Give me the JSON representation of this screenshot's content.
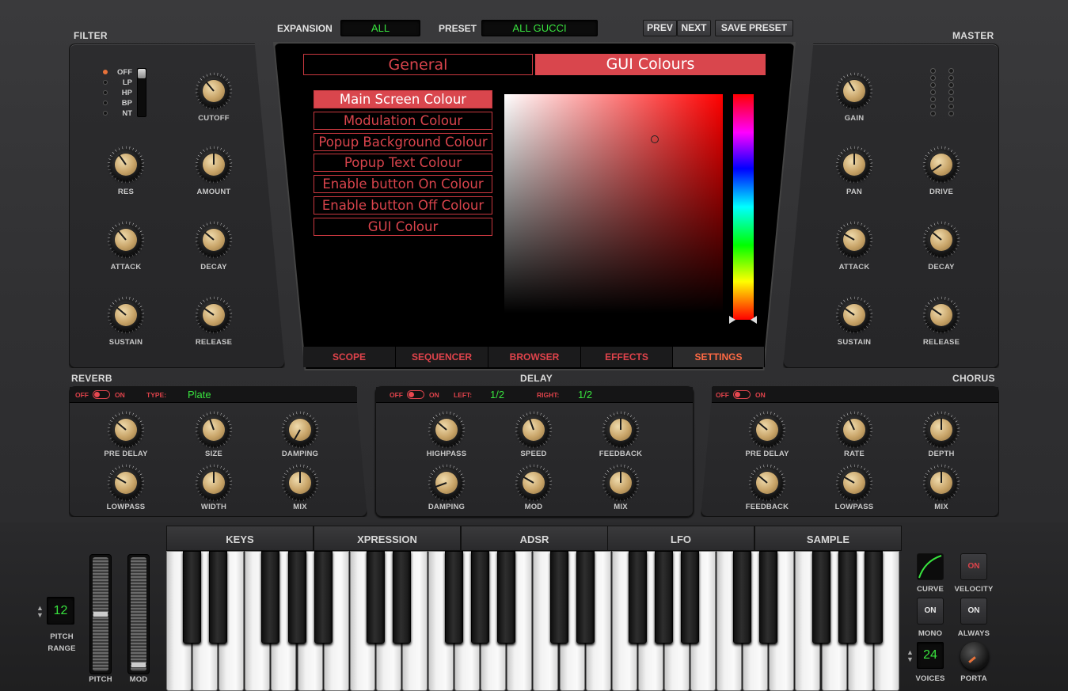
{
  "header": {
    "expansion_label": "EXPANSION",
    "expansion_value": "ALL",
    "preset_label": "PRESET",
    "preset_value": "ALL GUCCI",
    "prev": "PREV",
    "next": "NEXT",
    "save": "SAVE PRESET"
  },
  "filter": {
    "title": "FILTER",
    "modes": [
      "OFF",
      "LP",
      "HP",
      "BP",
      "NT"
    ],
    "active_mode": "OFF",
    "knobs": [
      {
        "label": "CUTOFF",
        "angle": -40
      },
      {
        "label": "RES",
        "angle": -35
      },
      {
        "label": "AMOUNT",
        "angle": 0
      },
      {
        "label": "ATTACK",
        "angle": -40
      },
      {
        "label": "DECAY",
        "angle": -50
      },
      {
        "label": "SUSTAIN",
        "angle": -50
      },
      {
        "label": "RELEASE",
        "angle": -55
      }
    ]
  },
  "master": {
    "title": "MASTER",
    "knobs": [
      {
        "label": "GAIN",
        "angle": -30
      },
      {
        "label": "PAN",
        "angle": 0
      },
      {
        "label": "DRIVE",
        "angle": -125
      },
      {
        "label": "ATTACK",
        "angle": -60
      },
      {
        "label": "DECAY",
        "angle": -50
      },
      {
        "label": "SUSTAIN",
        "angle": -55
      },
      {
        "label": "RELEASE",
        "angle": -55
      }
    ]
  },
  "screen": {
    "tabs": [
      "General",
      "GUI Colours"
    ],
    "active_tab": "GUI Colours",
    "colour_items": [
      "Main Screen Colour",
      "Modulation Colour",
      "Popup Background Colour",
      "Popup Text Colour",
      "Enable button On Colour",
      "Enable button Off Colour",
      "GUI Colour"
    ],
    "selected_item": "Main Screen Colour",
    "picker_hue": "#ff0000",
    "bottom_tabs": [
      "SCOPE",
      "SEQUENCER",
      "BROWSER",
      "EFFECTS",
      "SETTINGS"
    ],
    "active_bottom_tab": "SETTINGS"
  },
  "reverb": {
    "title": "REVERB",
    "off": "OFF",
    "on": "ON",
    "type_label": "TYPE:",
    "type_value": "Plate",
    "knobs": [
      {
        "label": "PRE DELAY",
        "angle": -50
      },
      {
        "label": "SIZE",
        "angle": -20
      },
      {
        "label": "DAMPING",
        "angle": -150
      },
      {
        "label": "LOWPASS",
        "angle": -60
      },
      {
        "label": "WIDTH",
        "angle": 0
      },
      {
        "label": "MIX",
        "angle": 0
      }
    ]
  },
  "delay": {
    "title": "DELAY",
    "off": "OFF",
    "on": "ON",
    "left_label": "LEFT:",
    "left_value": "1/2",
    "right_label": "RIGHT:",
    "right_value": "1/2",
    "knobs": [
      {
        "label": "HIGHPASS",
        "angle": -50
      },
      {
        "label": "SPEED",
        "angle": -20
      },
      {
        "label": "FEEDBACK",
        "angle": 0
      },
      {
        "label": "DAMPING",
        "angle": -110
      },
      {
        "label": "MOD",
        "angle": -60
      },
      {
        "label": "MIX",
        "angle": 0
      }
    ]
  },
  "chorus": {
    "title": "CHORUS",
    "off": "OFF",
    "on": "ON",
    "knobs": [
      {
        "label": "PRE DELAY",
        "angle": -50
      },
      {
        "label": "RATE",
        "angle": -25
      },
      {
        "label": "DEPTH",
        "angle": 0
      },
      {
        "label": "FEEDBACK",
        "angle": -50
      },
      {
        "label": "LOWPASS",
        "angle": -60
      },
      {
        "label": "MIX",
        "angle": 0
      }
    ]
  },
  "keyboard": {
    "tabs": [
      "KEYS",
      "XPRESSION",
      "ADSR",
      "LFO",
      "SAMPLE"
    ]
  },
  "controls": {
    "pitch_range_value": "12",
    "pitch_range_label": "PITCH\nRANGE",
    "pitch": "PITCH",
    "mod": "MOD",
    "curve": "CURVE",
    "velocity": "VELOCITY",
    "velocity_state": "ON",
    "mono": "MONO",
    "mono_state": "ON",
    "always": "ALWAYS",
    "always_state": "ON",
    "voices_value": "24",
    "voices": "VOICES",
    "porta": "PORTA"
  },
  "colors": {
    "accent": "#d9444c",
    "lcd_text": "#38e33e",
    "knob_cap": "#c8a468"
  }
}
